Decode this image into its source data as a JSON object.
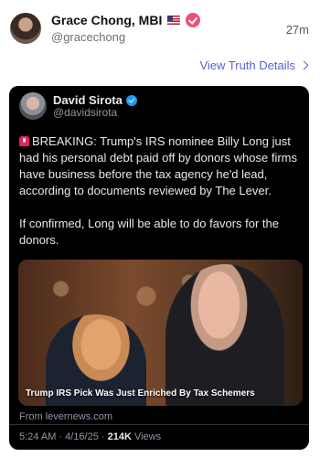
{
  "post": {
    "author_name": "Grace Chong, MBI",
    "author_handle": "@gracechong",
    "time_ago": "27m",
    "details_link": "View Truth Details"
  },
  "quoted": {
    "author_name": "David Sirota",
    "author_handle": "@davidsirota",
    "paragraphs": [
      "BREAKING: Trump's IRS nominee Billy Long just had his personal debt paid off by donors whose firms have business before the tax agency he'd lead, according to documents reviewed by The Lever.",
      "If confirmed, Long will be able to do favors for the donors."
    ],
    "media_caption": "Trump IRS Pick Was Just Enriched By Tax Schemers",
    "source": "From levernews.com",
    "timestamp": "5:24 AM · 4/16/25 · ",
    "views_count": "214K",
    "views_label": " Views"
  },
  "icons": {
    "flag": "us-flag-icon",
    "verified_author": "verified-badge-icon",
    "verified_quoted": "verified-check-icon",
    "siren": "siren-icon",
    "chevron": "chevron-right-icon"
  },
  "colors": {
    "link": "#5b5fd6",
    "verified_pink": "#ee4f7b",
    "verified_blue": "#1d9bf0",
    "card_bg": "#000000"
  }
}
